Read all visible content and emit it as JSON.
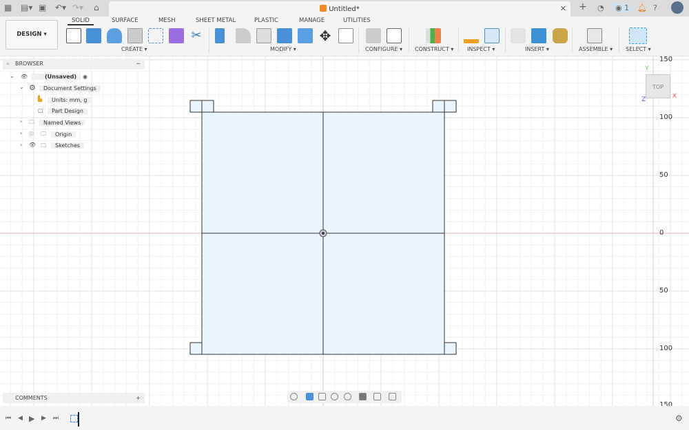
{
  "title_bar": {
    "document_title": "Untitled*",
    "notifications_count": "1"
  },
  "ribbon": {
    "workspace": "DESIGN",
    "tabs": [
      "SOLID",
      "SURFACE",
      "MESH",
      "SHEET METAL",
      "PLASTIC",
      "MANAGE",
      "UTILITIES"
    ],
    "active_tab": "SOLID",
    "groups": [
      "CREATE",
      "MODIFY",
      "CONFIGURE",
      "CONSTRUCT",
      "INSPECT",
      "INSERT",
      "ASSEMBLE",
      "SELECT"
    ]
  },
  "browser": {
    "title": "BROWSER",
    "root": "(Unsaved)",
    "items": [
      "Document Settings",
      "Units: mm, g",
      "Part Design",
      "Named Views",
      "Origin",
      "Sketches"
    ]
  },
  "comments": {
    "title": "COMMENTS"
  },
  "viewcube": {
    "face": "TOP",
    "axes": [
      "X",
      "Y",
      "Z"
    ]
  },
  "ruler_labels": [
    "150",
    "100",
    "50",
    "0",
    "50",
    "100",
    "150"
  ],
  "colors": {
    "accent": "#0696d7",
    "sketch_fill": "#eaf4fc",
    "x_axis": "#e57373",
    "y_axis": "#8bd08b"
  }
}
